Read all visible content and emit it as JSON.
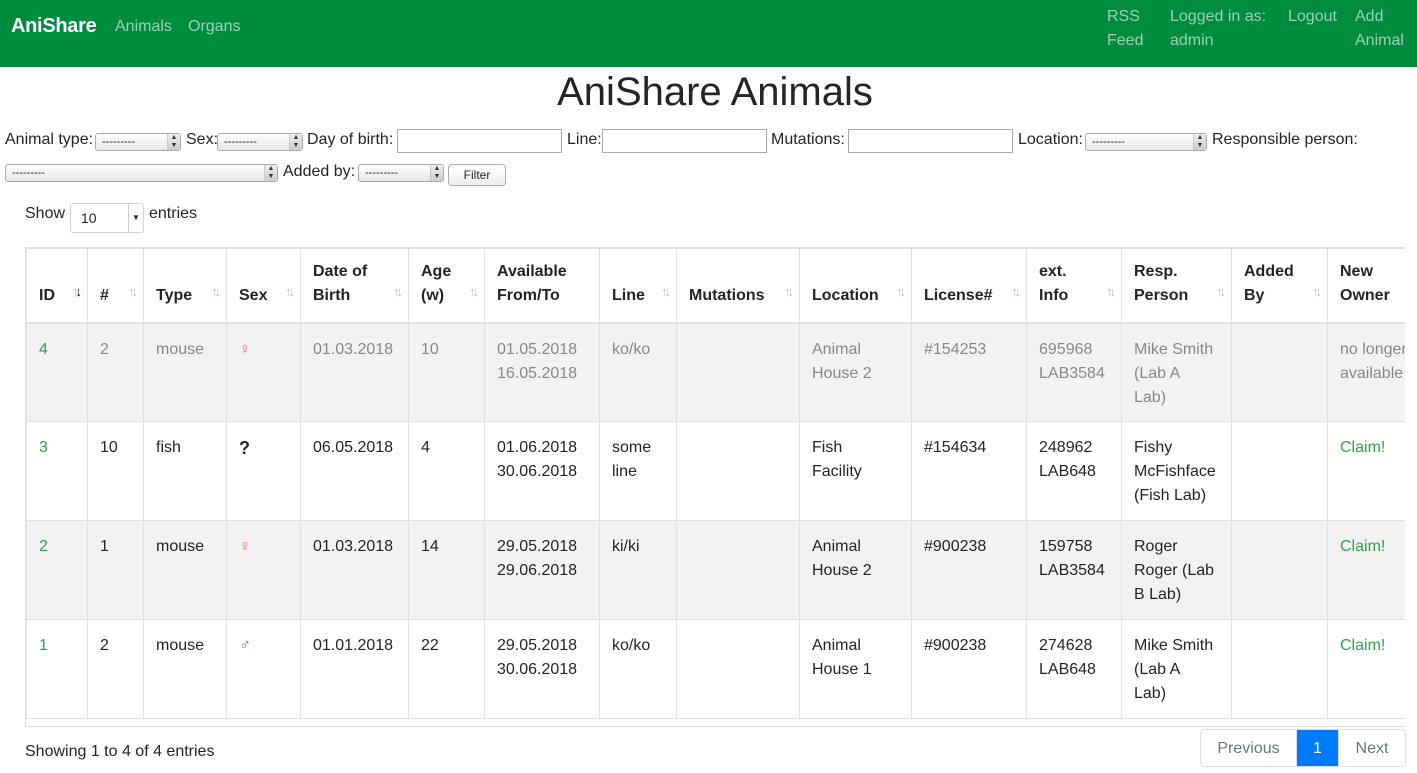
{
  "nav": {
    "brand": "AniShare",
    "links": [
      "Animals",
      "Organs"
    ],
    "rss_line1": "RSS",
    "rss_line2": "Feed",
    "logged_line1": "Logged in as:",
    "logged_line2": "admin",
    "logout": "Logout",
    "add_line1": "Add",
    "add_line2": "Animal"
  },
  "page_title": "AniShare Animals",
  "filters": {
    "animal_type_label": "Animal type:",
    "animal_type_value": "---------",
    "sex_label": "Sex:",
    "sex_value": "---------",
    "dob_label": "Day of birth:",
    "line_label": "Line:",
    "mutations_label": "Mutations:",
    "location_label": "Location:",
    "location_value": "---------",
    "responsible_label": "Responsible person:",
    "responsible_value": "---------",
    "added_by_label": "Added by:",
    "added_by_value": "---------",
    "filter_button": "Filter"
  },
  "length": {
    "show_label": "Show",
    "value": "10",
    "entries_label": "entries"
  },
  "table": {
    "headers": {
      "id": "ID",
      "count": "#",
      "type": "Type",
      "sex": "Sex",
      "dob_1": "Date of",
      "dob_2": "Birth",
      "age_1": "Age",
      "age_2": "(w)",
      "avail_1": "Available",
      "avail_2": "From/To",
      "line": "Line",
      "mutations": "Mutations",
      "location": "Location",
      "license": "License#",
      "ext_1": "ext.",
      "ext_2": "Info",
      "resp_1": "Resp.",
      "resp_2": "Person",
      "added_1": "Added",
      "added_2": "By",
      "owner_1": "New",
      "owner_2": "Owner"
    },
    "rows": [
      {
        "id": "4",
        "count": "2",
        "type": "mouse",
        "sex": "♀",
        "dob": "01.03.2018",
        "age": "10",
        "from": "01.05.2018",
        "to": "16.05.2018",
        "line": "ko/ko",
        "mutations": "",
        "loc_1": "Animal",
        "loc_2": "House 2",
        "license": "#154253",
        "ext_1": "695968",
        "ext_2": "LAB3584",
        "resp_1": "Mike Smith",
        "resp_2": "(Lab A",
        "resp_3": "Lab)",
        "added_by": "",
        "owner_1": "no longer",
        "owner_2": "available"
      },
      {
        "id": "3",
        "count": "10",
        "type": "fish",
        "sex": "?",
        "dob": "06.05.2018",
        "age": "4",
        "from": "01.06.2018",
        "to": "30.06.2018",
        "line_1": "some",
        "line_2": "line",
        "mutations": "",
        "loc_1": "Fish",
        "loc_2": "Facility",
        "license": "#154634",
        "ext_1": "248962",
        "ext_2": "LAB648",
        "resp_1": "Fishy",
        "resp_2": "McFishface",
        "resp_3": "(Fish Lab)",
        "added_by": "",
        "owner": "Claim!"
      },
      {
        "id": "2",
        "count": "1",
        "type": "mouse",
        "sex": "♀",
        "dob": "01.03.2018",
        "age": "14",
        "from": "29.05.2018",
        "to": "29.06.2018",
        "line": "ki/ki",
        "mutations": "",
        "loc_1": "Animal",
        "loc_2": "House 2",
        "license": "#900238",
        "ext_1": "159758",
        "ext_2": "LAB3584",
        "resp_1": "Roger",
        "resp_2": "Roger (Lab",
        "resp_3": "B Lab)",
        "added_by": "",
        "owner": "Claim!"
      },
      {
        "id": "1",
        "count": "2",
        "type": "mouse",
        "sex": "♂",
        "dob": "01.01.2018",
        "age": "22",
        "from": "29.05.2018",
        "to": "30.06.2018",
        "line": "ko/ko",
        "mutations": "",
        "loc_1": "Animal",
        "loc_2": "House 1",
        "license": "#900238",
        "ext_1": "274628",
        "ext_2": "LAB648",
        "resp_1": "Mike Smith",
        "resp_2": "(Lab A",
        "resp_3": "Lab)",
        "added_by": "",
        "owner": "Claim!"
      }
    ]
  },
  "footer": {
    "info": "Showing 1 to 4 of 4 entries",
    "previous": "Previous",
    "page": "1",
    "next": "Next"
  },
  "colors": {
    "navbar": "#008c3f",
    "link_green": "#28a745",
    "page_active": "#007bff",
    "female": "#ff6b6b",
    "male": "#6a6ae0"
  }
}
